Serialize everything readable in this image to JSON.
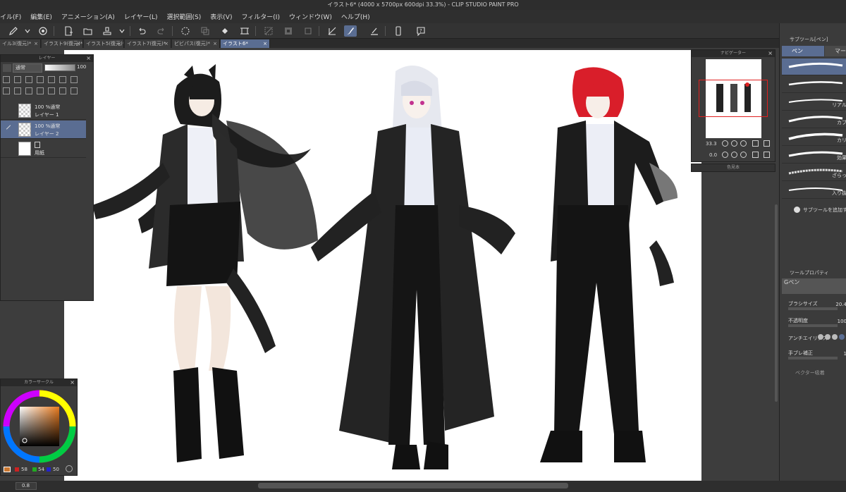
{
  "window": {
    "title": "イラスト6* (4000 x 5700px 600dpi 33.3%) - CLIP STUDIO PAINT PRO"
  },
  "menu": [
    {
      "label": "イル(F)"
    },
    {
      "label": "編集(E)"
    },
    {
      "label": "アニメーション(A)"
    },
    {
      "label": "レイヤー(L)"
    },
    {
      "label": "選択範囲(S)"
    },
    {
      "label": "表示(V)"
    },
    {
      "label": "フィルター(I)"
    },
    {
      "label": "ウィンドウ(W)"
    },
    {
      "label": "ヘルプ(H)"
    }
  ],
  "tabs": [
    {
      "label": "イル3(復元)*"
    },
    {
      "label": "イラスト9(復元)*"
    },
    {
      "label": "イラスト5(復元)*"
    },
    {
      "label": "イラスト7(復元)*"
    },
    {
      "label": "ビビパス(復元)*"
    },
    {
      "label": "イラスト6*"
    }
  ],
  "layer_panel": {
    "title": "レイヤー",
    "blend_mode": "通常",
    "opacity": "100",
    "layers": [
      {
        "blend": "100 %通常",
        "name": "レイヤー 1"
      },
      {
        "blend": "100 %通常",
        "name": "レイヤー 2"
      },
      {
        "blend": "",
        "name": "用紙"
      }
    ]
  },
  "color_panel": {
    "title": "カラーサークル",
    "r": "58",
    "g": "54",
    "b": "50",
    "colors": {
      "main": "#c9762f",
      "sub": "#ffffff"
    }
  },
  "navigator": {
    "title": "ナビゲーター",
    "zoom": "33.3",
    "rotation": "0.0"
  },
  "sub_panel_small": {
    "title": "色見本"
  },
  "subtool_panel": {
    "header": "サブツール[ペン]",
    "tab_pen": "ペン",
    "tab_marker": "マー",
    "brushes": [
      {
        "label": ""
      },
      {
        "label": ""
      },
      {
        "label": "リアル"
      },
      {
        "label": "カブ"
      },
      {
        "label": "カリ"
      },
      {
        "label": "効果"
      },
      {
        "label": "ざらっ"
      },
      {
        "label": "入り抜"
      }
    ],
    "add_label": "サブツールを追加す"
  },
  "tool_property": {
    "header": "ツールプロパティ",
    "brush_name": "Gペン",
    "brush_size_label": "ブラシサイズ",
    "brush_size_value": "20.4",
    "opacity_label": "不透明度",
    "opacity_value": "100",
    "antialias_label": "アンチエイリアス",
    "stabilize_label": "手ブレ補正",
    "stabilize_value": "1",
    "vector_label": "ベクター吸着"
  },
  "status": {
    "zoom": "0.8"
  },
  "ui_colors": {
    "accent": "#5a6d92",
    "panel": "#3b3b3b",
    "canvas": "#ffffff"
  }
}
